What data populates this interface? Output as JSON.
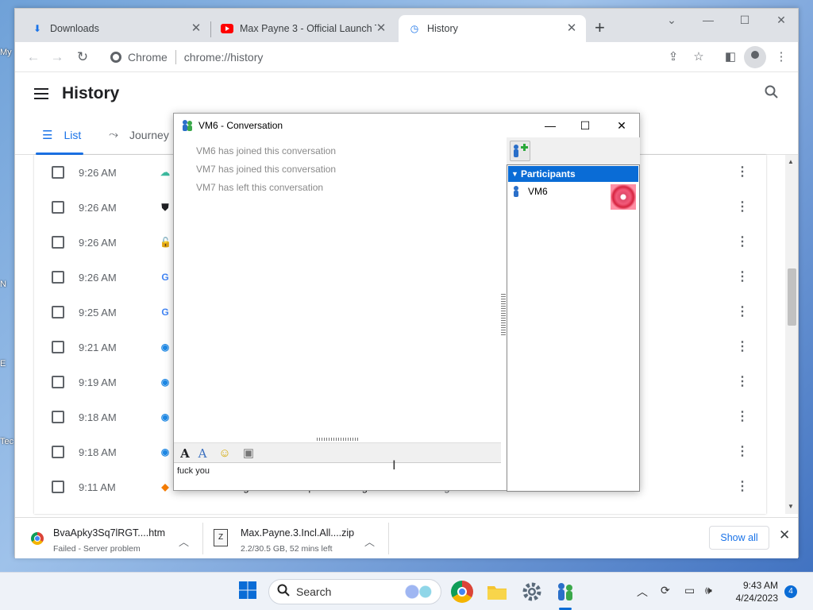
{
  "desktop": {
    "labels": [
      "My",
      "N",
      "E",
      "Tec"
    ]
  },
  "browser": {
    "tabs": [
      {
        "label": "Downloads",
        "icon": "download-icon",
        "active": false
      },
      {
        "label": "Max Payne 3 - Official Launch Tr",
        "icon": "youtube-icon",
        "active": false
      },
      {
        "label": "History",
        "icon": "history-icon",
        "active": true
      }
    ],
    "omnibox": {
      "site": "Chrome",
      "url": "chrome://history"
    }
  },
  "history": {
    "title": "History",
    "tabs": [
      {
        "label": "List"
      },
      {
        "label": "Journey"
      }
    ],
    "rows": [
      {
        "time": "9:26 AM",
        "favicon": "cloud-icon",
        "fav_color": "#3cba9f",
        "title": "",
        "domain": ""
      },
      {
        "time": "9:26 AM",
        "favicon": "shield-icon",
        "fav_color": "#202124",
        "title": "",
        "domain": ""
      },
      {
        "time": "9:26 AM",
        "favicon": "lock-icon",
        "fav_color": "#e53935",
        "title": "",
        "domain": ""
      },
      {
        "time": "9:26 AM",
        "favicon": "google-icon",
        "fav_color": "#4285f4",
        "title": "",
        "domain": ""
      },
      {
        "time": "9:25 AM",
        "favicon": "google-icon",
        "fav_color": "#4285f4",
        "title": "",
        "domain": ""
      },
      {
        "time": "9:21 AM",
        "favicon": "globe-icon",
        "fav_color": "#1e88e5",
        "title": "",
        "domain": ""
      },
      {
        "time": "9:19 AM",
        "favicon": "globe-icon",
        "fav_color": "#1e88e5",
        "title": "",
        "domain": ""
      },
      {
        "time": "9:18 AM",
        "favicon": "globe-icon",
        "fav_color": "#1e88e5",
        "title": "",
        "domain": ""
      },
      {
        "time": "9:18 AM",
        "favicon": "globe-icon",
        "fav_color": "#1e88e5",
        "title": "",
        "domain": ""
      },
      {
        "time": "9:11 AM",
        "favicon": "sourceforge-icon",
        "fav_color": "#f57c00",
        "title": "LAN Messenger download | SourceForge.net",
        "domain": "sourceforge.net"
      }
    ]
  },
  "downloads": {
    "items": [
      {
        "name": "BvaApky3Sq7lRGT....htm",
        "status": "Failed - Server problem"
      },
      {
        "name": "Max.Payne.3.Incl.All....zip",
        "status": "2.2/30.5 GB, 52 mins left"
      }
    ],
    "show_all": "Show all"
  },
  "conversation": {
    "title": "VM6 - Conversation",
    "messages": [
      "VM6 has joined this conversation",
      "VM7 has joined this conversation",
      "VM7 has left this conversation"
    ],
    "input_text": "fuck you",
    "participants_header": "Participants",
    "participants": [
      {
        "name": "VM6"
      }
    ]
  },
  "taskbar": {
    "search_label": "Search",
    "time": "9:43 AM",
    "date": "4/24/2023",
    "notification_count": "4"
  }
}
